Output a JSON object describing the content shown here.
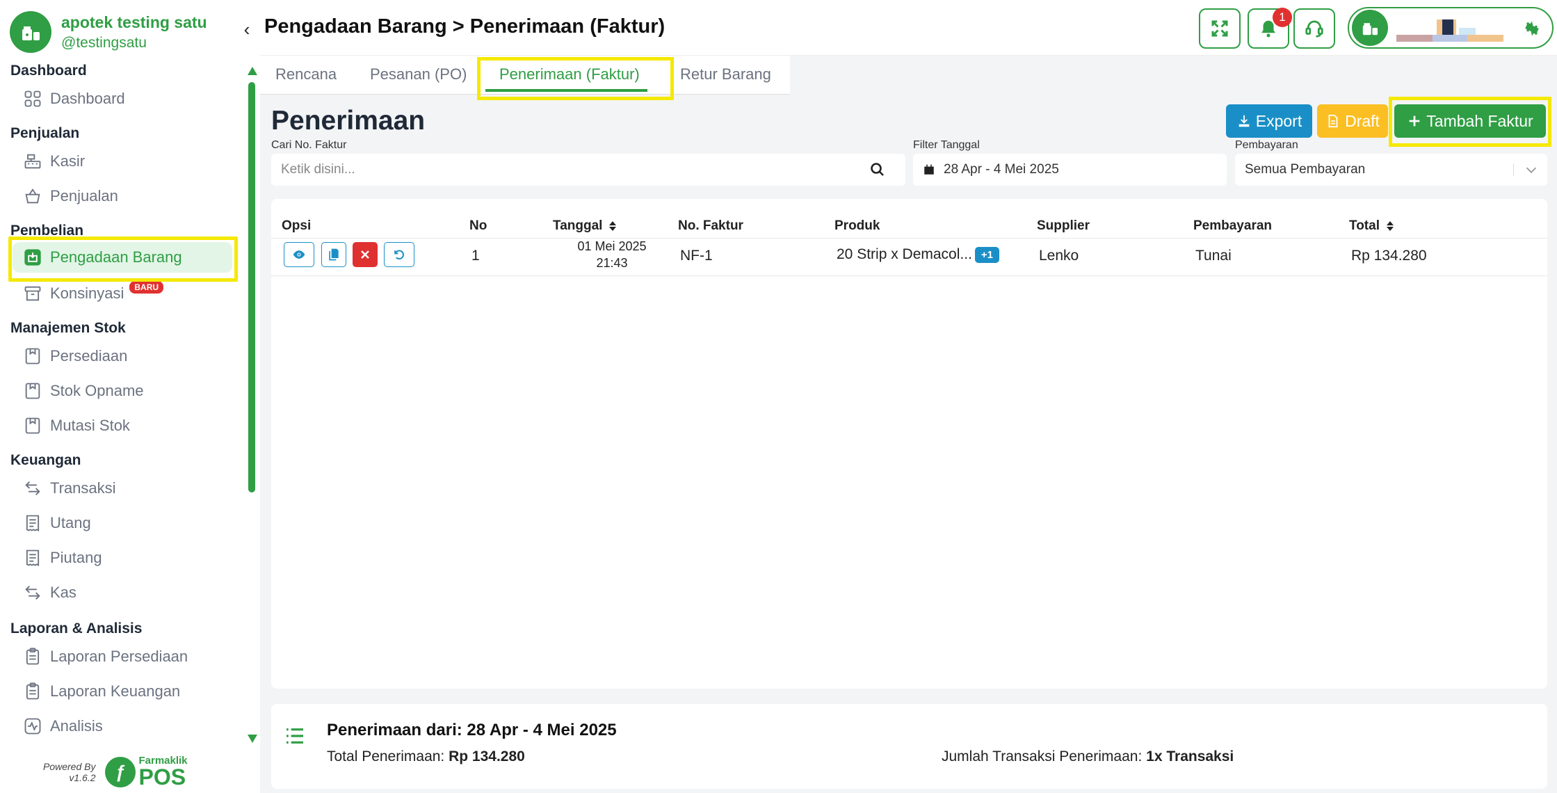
{
  "brand": {
    "name": "apotek testing satu",
    "handle": "@testingsatu"
  },
  "sidebar": {
    "sections": [
      {
        "title": "Dashboard",
        "items": [
          {
            "label": "Dashboard",
            "icon": "grid-icon"
          }
        ]
      },
      {
        "title": "Penjualan",
        "items": [
          {
            "label": "Kasir",
            "icon": "cash-register-icon"
          },
          {
            "label": "Penjualan",
            "icon": "basket-icon"
          }
        ]
      },
      {
        "title": "Pembelian",
        "items": [
          {
            "label": "Pengadaan Barang",
            "icon": "box-in-icon",
            "active": true
          },
          {
            "label": "Konsinyasi",
            "icon": "archive-icon",
            "badge": "BARU"
          }
        ]
      },
      {
        "title": "Manajemen Stok",
        "items": [
          {
            "label": "Persediaan",
            "icon": "package-icon"
          },
          {
            "label": "Stok Opname",
            "icon": "package-icon"
          },
          {
            "label": "Mutasi Stok",
            "icon": "package-icon"
          }
        ]
      },
      {
        "title": "Keuangan",
        "items": [
          {
            "label": "Transaksi",
            "icon": "transfer-icon"
          },
          {
            "label": "Utang",
            "icon": "receipt-icon"
          },
          {
            "label": "Piutang",
            "icon": "receipt-icon"
          },
          {
            "label": "Kas",
            "icon": "transfer-icon"
          }
        ]
      },
      {
        "title": "Laporan & Analisis",
        "items": [
          {
            "label": "Laporan Persediaan",
            "icon": "clipboard-icon"
          },
          {
            "label": "Laporan Keuangan",
            "icon": "clipboard-icon"
          },
          {
            "label": "Analisis",
            "icon": "activity-icon"
          }
        ]
      }
    ]
  },
  "powered": {
    "label": "Powered By",
    "version": "v1.6.2",
    "logo_small": "Farmaklik",
    "logo_big": "POS"
  },
  "header": {
    "breadcrumb": "Pengadaan Barang > Penerimaan (Faktur)",
    "notification_count": "1"
  },
  "tabs": [
    "Rencana",
    "Pesanan (PO)",
    "Penerimaan (Faktur)",
    "Retur Barang"
  ],
  "page": {
    "title": "Penerimaan"
  },
  "actions": {
    "export": "Export",
    "draft": "Draft",
    "add": "Tambah Faktur"
  },
  "filters": {
    "search_label": "Cari No. Faktur",
    "search_placeholder": "Ketik disini...",
    "date_label": "Filter Tanggal",
    "date_value": "28 Apr - 4 Mei 2025",
    "payment_label": "Pembayaran",
    "payment_value": "Semua Pembayaran"
  },
  "table": {
    "headers": [
      "Opsi",
      "No",
      "Tanggal",
      "No. Faktur",
      "Produk",
      "Supplier",
      "Pembayaran",
      "Total"
    ],
    "rows": [
      {
        "no": "1",
        "date": "01 Mei 2025",
        "time": "21:43",
        "invoice": "NF-1",
        "product": "20 Strip x Demacol...",
        "extra": "+1",
        "supplier": "Lenko",
        "payment": "Tunai",
        "total": "Rp 134.280"
      }
    ]
  },
  "summary": {
    "title": "Penerimaan dari: 28 Apr - 4 Mei 2025",
    "total_label": "Total Penerimaan:",
    "total_value": "Rp 134.280",
    "count_label": "Jumlah Transaksi Penerimaan:",
    "count_value": "1x Transaksi"
  },
  "colors": {
    "brand": "#2f9e44",
    "export": "#1a8fc7",
    "draft": "#fbbf24",
    "danger": "#e03131",
    "highlight": "#f5e900"
  }
}
